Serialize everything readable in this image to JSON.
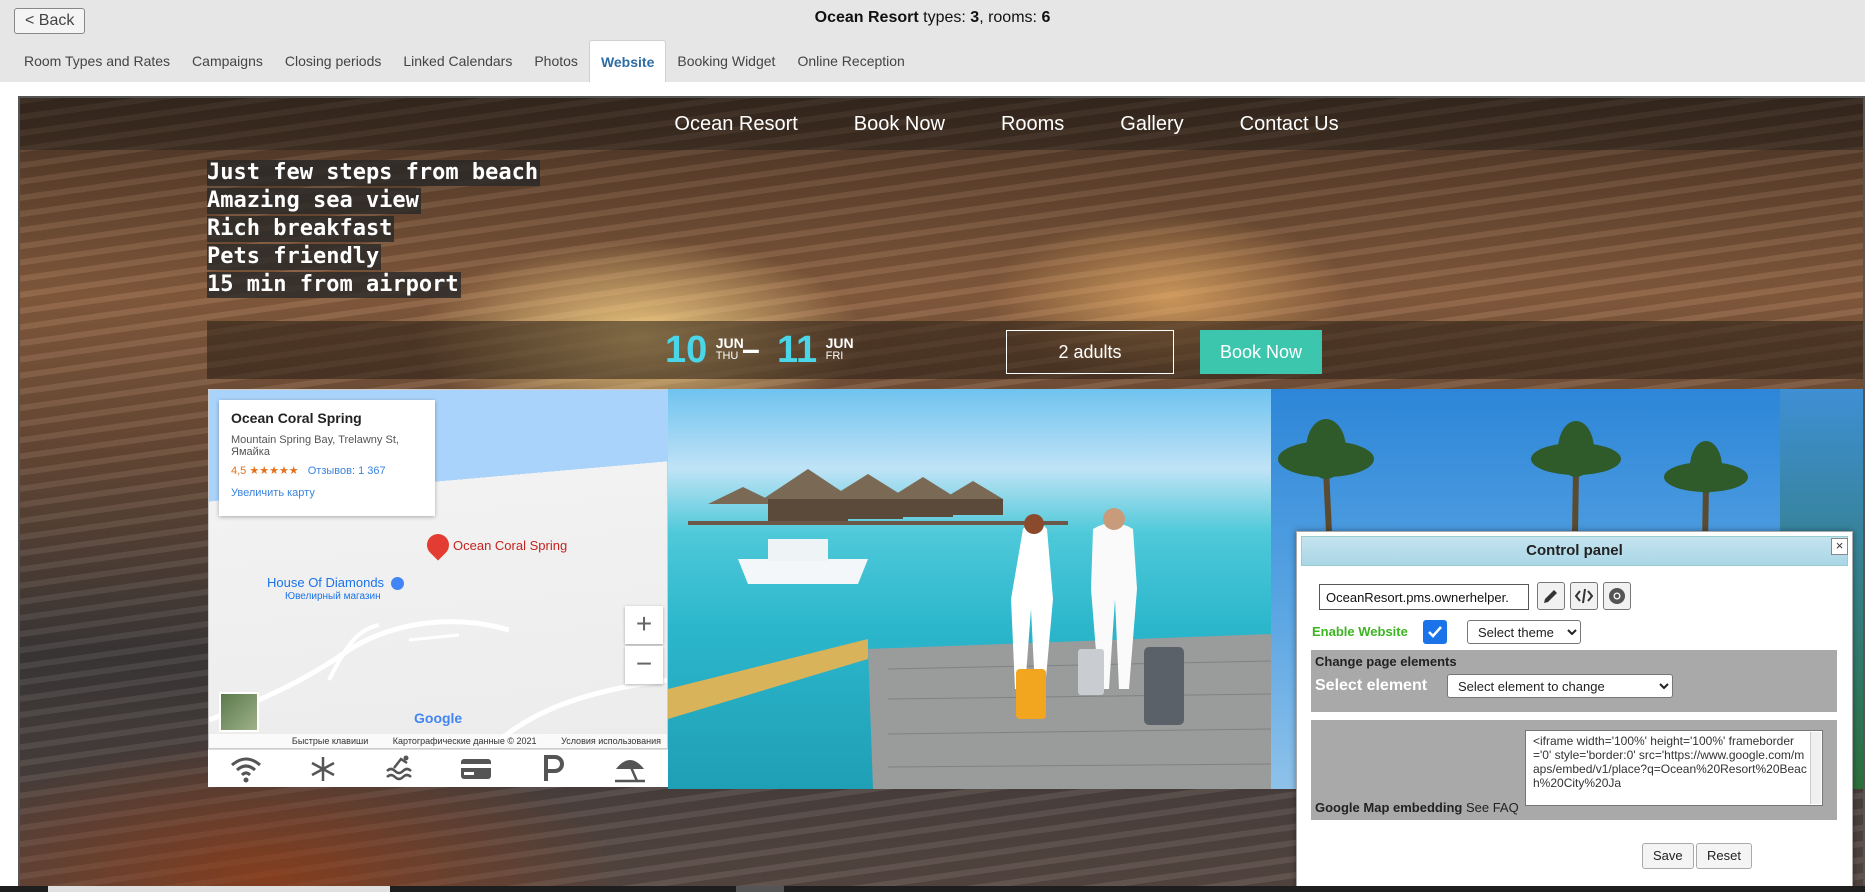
{
  "header": {
    "back_label": "Back",
    "property_name": "Ocean Resort",
    "types_label": "types:",
    "types_count": "3",
    "rooms_label": ", rooms:",
    "rooms_count": "6"
  },
  "tabs": [
    {
      "label": "Room Types and Rates",
      "active": false
    },
    {
      "label": "Campaigns",
      "active": false
    },
    {
      "label": "Closing periods",
      "active": false
    },
    {
      "label": "Linked Calendars",
      "active": false
    },
    {
      "label": "Photos",
      "active": false
    },
    {
      "label": "Website",
      "active": true
    },
    {
      "label": "Booking Widget",
      "active": false
    },
    {
      "label": "Online Reception",
      "active": false
    }
  ],
  "site": {
    "nav": [
      "Ocean Resort",
      "Book Now",
      "Rooms",
      "Gallery",
      "Contact Us"
    ],
    "hero_lines": [
      "Just few steps from beach",
      "Amazing sea view",
      "Rich breakfast",
      "Pets friendly",
      "15 min from airport"
    ],
    "booking": {
      "checkin_day": "10",
      "checkin_month": "JUN",
      "checkin_dow": "THU",
      "checkout_day": "11",
      "checkout_month": "JUN",
      "checkout_dow": "FRI",
      "dash": "–",
      "guests": "2 adults",
      "book_label": "Book Now",
      "accent_color": "#3cc6ad",
      "date_color": "#4ad6e8"
    },
    "map": {
      "place_name": "Ocean Coral Spring",
      "address": "Mountain Spring Bay, Trelawny St, Ямайка",
      "rating": "4,5",
      "stars": "★★★★★",
      "reviews": "Отзывов: 1 367",
      "enlarge": "Увеличить карту",
      "pin_label": "Ocean Coral Spring",
      "poi_name": "House Of Diamonds",
      "poi_sub": "Ювелирный магазин",
      "zoom_in": "+",
      "zoom_out": "−",
      "google": "Google",
      "footer": [
        "Быстрые клавиши",
        "Картографические данные © 2021",
        "Условия использования"
      ]
    },
    "amenity_icons": [
      "wifi-icon",
      "snowflake-icon",
      "pool-icon",
      "credit-card-icon",
      "parking-icon",
      "beach-umbrella-icon"
    ]
  },
  "control_panel": {
    "title": "Control panel",
    "close": "×",
    "url_value": "OceanResort.pms.ownerhelper.",
    "tool_icons": [
      "edit-icon",
      "code-icon",
      "chrome-icon"
    ],
    "enable_label": "Enable Website",
    "enable_checked": true,
    "theme_select": "Select theme",
    "change_title": "Change page elements",
    "select_label": "Select element",
    "element_select": "Select element to change",
    "map_label": "Google Map embedding",
    "faq_label": "See FAQ",
    "map_code": "<iframe width='100%' height='100%' frameborder='0' style='border:0' src='https://www.google.com/maps/embed/v1/place?q=Ocean%20Resort%20Beach%20City%20Ja",
    "save": "Save",
    "reset": "Reset"
  }
}
